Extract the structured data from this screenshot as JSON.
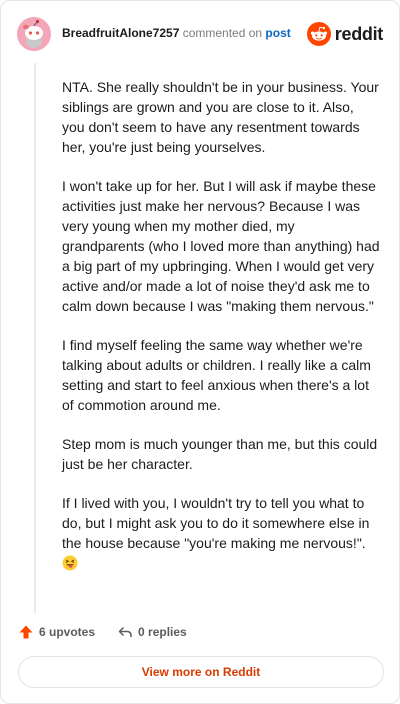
{
  "header": {
    "username": "BreadfruitAlone7257",
    "action_text": " commented on ",
    "post_link": "post",
    "brand_name": "reddit"
  },
  "comment": {
    "paragraphs": [
      "NTA. She really shouldn't be in your business. Your siblings are grown and you are close to it. Also, you don't seem to have any resentment towards her, you're just being yourselves.",
      "I won't take up for her. But I will ask if maybe these activities just make her nervous? Because I was very young when my mother died, my grandparents (who I loved more than anything) had a big part of my upbringing. When I would get very active and/or made a lot of noise they'd ask me to calm down because I was \"making them nervous.\"",
      "I find myself feeling the same way whether we're talking about adults or children. I really like a calm setting and start to feel anxious when there's a lot of commotion around me.",
      "Step mom is much younger than me, but this could just be her character.",
      "If I lived with you, I wouldn't try to tell you what to do, but I might ask you to do it somewhere else in the house because \"you're making me nervous!\"."
    ],
    "emoji": "grinning-squinting-tongue-emoji"
  },
  "footer": {
    "upvotes": "6 upvotes",
    "replies": "0 replies",
    "view_more": "View more on Reddit"
  },
  "colors": {
    "brand_orange": "#ff4500",
    "link_blue": "#0a66c2",
    "view_more_text": "#d93a00",
    "avatar_bg": "#f3a6b7"
  }
}
